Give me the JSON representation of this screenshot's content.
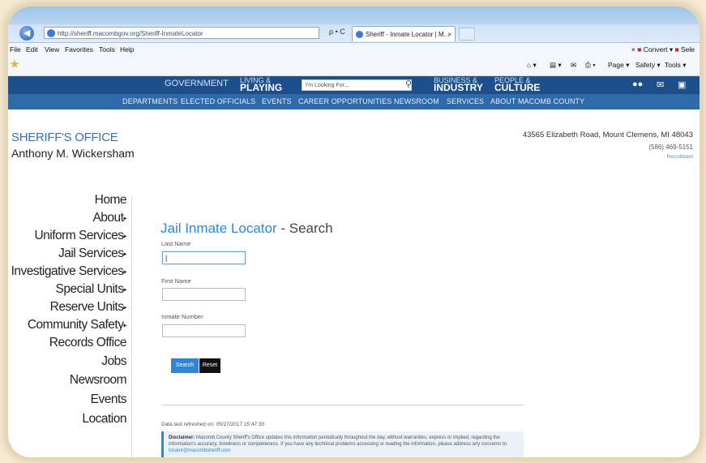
{
  "browser": {
    "url": "http://sheriff.macombgov.org/Sheriff-InmateLocator",
    "url_controls": "ρ • C",
    "tab_title": "Sheriff - Inmate Locator | M...",
    "tab_close": "×",
    "menu": [
      "File",
      "Edit",
      "View",
      "Favorites",
      "Tools",
      "Help"
    ],
    "right_tools": {
      "close_x": "×",
      "convert": "Convert ▾",
      "select": "Sele"
    },
    "command_bar": [
      "Page ▾",
      "Safety ▾",
      "Tools ▾"
    ],
    "back_glyph": "◀"
  },
  "site_nav": {
    "government": "GOVERNMENT",
    "living_small": "LIVING &",
    "living_big": "PLAYING",
    "search_placeholder": "I'm Looking For...",
    "business_small": "BUSINESS &",
    "business_big": "INDUSTRY",
    "people_small": "PEOPLE &",
    "people_big": "CULTURE",
    "sub_items": [
      "DEPARTMENTS",
      "ELECTED OFFICIALS",
      "EVENTS",
      "CAREER OPPORTUNITIES",
      "NEWSROOM",
      "SERVICES",
      "ABOUT MACOMB COUNTY"
    ]
  },
  "header": {
    "office": "SHERIFF'S OFFICE",
    "name": "Anthony M. Wickersham",
    "address": "43565 Elizabeth Road, Mount Clemens, MI 48043",
    "phone": "(586) 469-5151",
    "recruit": "Recruitment"
  },
  "sidebar": {
    "items": [
      {
        "label": "Home",
        "arrow": ""
      },
      {
        "label": "About",
        "arrow": "▸"
      },
      {
        "label": "Uniform Services",
        "arrow": "▸"
      },
      {
        "label": "Jail Services",
        "arrow": "▸"
      },
      {
        "label": "Investigative Services",
        "arrow": "▸"
      },
      {
        "label": "Special Units",
        "arrow": "▸"
      },
      {
        "label": "Reserve Units",
        "arrow": "▸"
      },
      {
        "label": "Community Safety",
        "arrow": "▸"
      },
      {
        "label": "Records Office",
        "arrow": ""
      },
      {
        "label": "Jobs",
        "arrow": ""
      },
      {
        "label": "Newsroom",
        "arrow": ""
      },
      {
        "label": "Events",
        "arrow": ""
      },
      {
        "label": "Location",
        "arrow": ""
      }
    ]
  },
  "form": {
    "title_main": "Jail Inmate Locator",
    "title_sep": " - Search",
    "last_name_label": "Last Name",
    "last_name_value": "|",
    "first_name_label": "First Name",
    "inmate_number_label": "Inmate Number",
    "search_button": "Search",
    "reset_button": "Reset",
    "refreshed": "Data last refreshed on: 05/27/2017 15:47:30",
    "disclaimer_bold": "Disclaimer:",
    "disclaimer_text": " Macomb County Sheriff's Office updates this information periodically throughout the day, without warranties, express or implied, regarding the information's accuracy, timeliness or completeness. If you have any technical problems accessing or reading the information, please address any concerns to ",
    "disclaimer_email": "locator@macombsheriff.com"
  },
  "colors": {
    "nav_dark": "#1f4f8a",
    "nav_sub": "#2e6aa9",
    "accent": "#2e86d6"
  }
}
